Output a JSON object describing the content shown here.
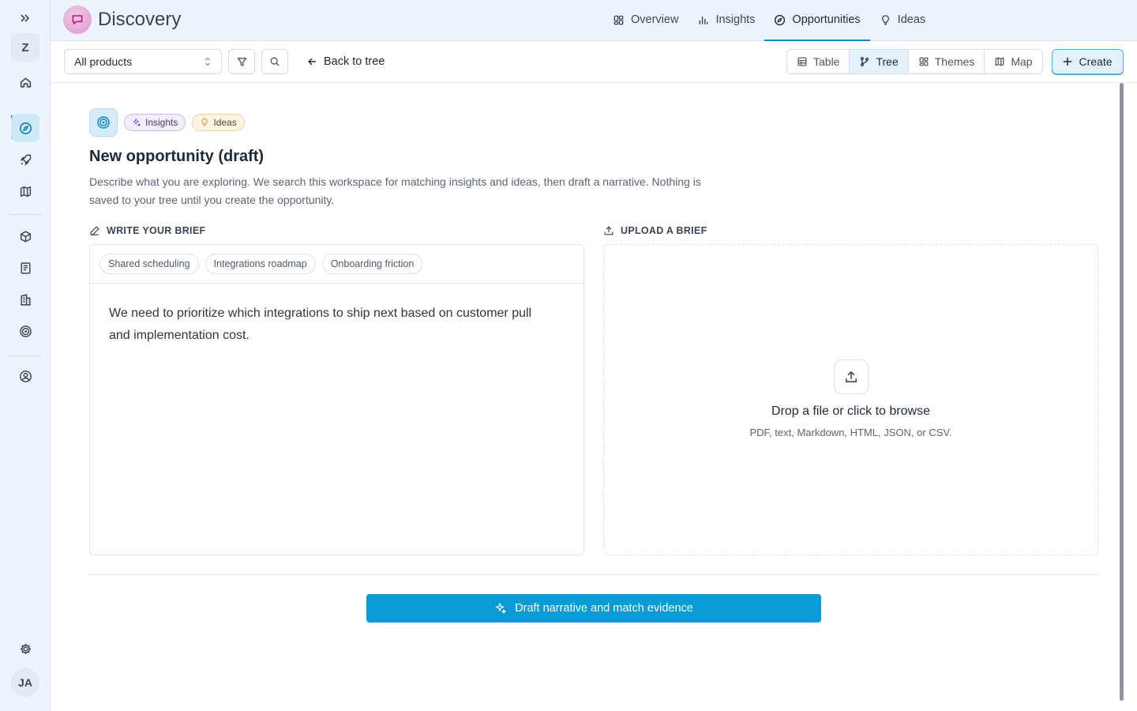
{
  "app": {
    "name": "Discovery"
  },
  "rail": {
    "workspace_letter": "Z",
    "user_initials": "JA"
  },
  "nav": {
    "overview": "Overview",
    "insights": "Insights",
    "opportunities": "Opportunities",
    "ideas": "Ideas"
  },
  "toolbar": {
    "product_filter": "All products",
    "back_label": "Back to tree",
    "views": {
      "table": "Table",
      "tree": "Tree",
      "themes": "Themes",
      "map": "Map"
    },
    "create_label": "Create"
  },
  "draft": {
    "chips": {
      "insights": "Insights",
      "ideas": "Ideas"
    },
    "title": "New opportunity (draft)",
    "description": "Describe what you are exploring. We search this workspace for matching insights and ideas, then draft a narrative. Nothing is saved to your tree until you create the opportunity."
  },
  "brief": {
    "label": "WRITE YOUR BRIEF",
    "suggestions": [
      "Shared scheduling",
      "Integrations roadmap",
      "Onboarding friction"
    ],
    "text": "We need to prioritize which integrations to ship next based on customer pull and implementation cost."
  },
  "upload": {
    "label": "UPLOAD A BRIEF",
    "title": "Drop a file or click to browse",
    "subtitle": "PDF, text, Markdown, HTML, JSON, or CSV."
  },
  "action": {
    "label": "Draft narrative and match evidence"
  },
  "colors": {
    "accent": "#0a9ad6",
    "active_tab": "#0a8fd0"
  }
}
